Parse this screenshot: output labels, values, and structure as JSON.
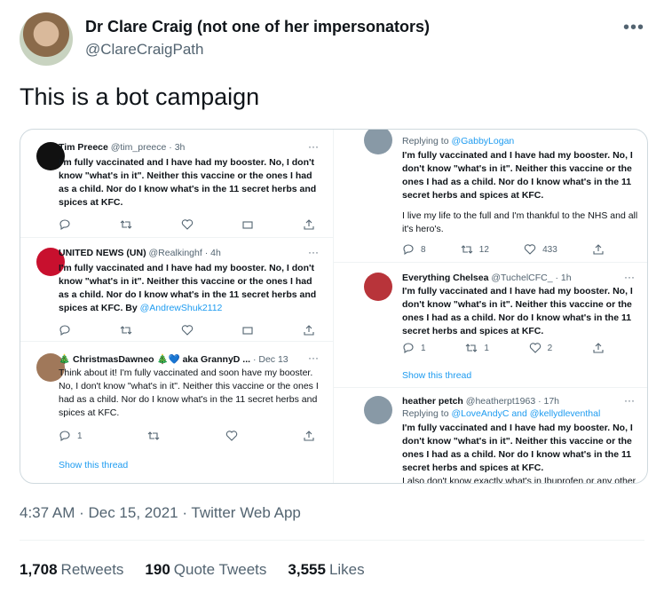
{
  "author": {
    "name": "Dr Clare Craig (not one of her impersonators)",
    "handle": "@ClareCraigPath",
    "more_icon": "more-horizontal-icon"
  },
  "tweet_text": "This is a bot campaign",
  "media": {
    "left": [
      {
        "name": "Tim Preece",
        "meta": "@tim_preece · 3h",
        "text": "I'm fully vaccinated and I  have had my booster. No, I don't know \"what's in it\". Neither this vaccine or the ones I had as a child. Nor do I know what's in the 11 secret herbs and spices at KFC.",
        "actions": [
          "",
          "",
          "",
          "",
          ""
        ]
      },
      {
        "name": "UNITED NEWS (UN)",
        "meta": "@Realkinghf · 4h",
        "text": "I'm fully vaccinated and I  have had my booster. No, I don't know \"what's in it\". Neither this vaccine or the ones I had as a child. Nor do I know what's in the 11 secret herbs and spices at KFC. By",
        "mention": "@AndrewShuk2112"
      },
      {
        "name": "🎄 ChristmasDawneo 🎄💙 aka GrannyD ...",
        "meta": "· Dec 13",
        "text": "Think about it! I'm fully vaccinated and soon have my booster. No, I don't know \"what's in it\". Neither this vaccine or the ones I had as a child. Nor do I know what's in the 11 secret herbs and spices at KFC.",
        "reply_count": "1",
        "show_thread": "Show this thread"
      }
    ],
    "right": [
      {
        "replying_label": "Replying to",
        "replying_to": "@GabbyLogan",
        "text": "I'm fully vaccinated and I have had my booster. No, I don't know \"what's in it\". Neither this vaccine or the ones I had as a child. Nor do I know what's in the 11 secret herbs and spices at KFC.",
        "text2": "I live my life to the full and I'm thankful to the NHS and all it's hero's.",
        "replies": "8",
        "retweets": "12",
        "likes": "433"
      },
      {
        "name": "Everything Chelsea",
        "meta": "@TuchelCFC_ · 1h",
        "text": "I'm fully vaccinated and I  have had my booster. No, I don't know \"what's in it\". Neither this vaccine or the ones I had as a child. Nor do I know what's in the 11 secret herbs and spices at KFC.",
        "replies": "1",
        "retweets": "1",
        "likes": "2",
        "show_thread": "Show this thread"
      },
      {
        "name": "heather petch",
        "meta": "@heatherpt1963 · 17h",
        "replying_label": "Replying to",
        "replying_to": "@LoveAndyC and @kellydleventhal",
        "text": "I'm fully vaccinated and I have had my booster. No, I don't know \"what's in it\". Neither this vaccine or the ones I had as a child. Nor do I know what's in the 11 secret herbs and spices at KFC.",
        "text2": "I also don't know exactly what's in Ibuprofen or any other"
      }
    ]
  },
  "timestamp": "4:37 AM · Dec 15, 2021 · Twitter Web App",
  "stats": {
    "retweets_count": "1,708",
    "retweets_label": "Retweets",
    "quotes_count": "190",
    "quotes_label": "Quote Tweets",
    "likes_count": "3,555",
    "likes_label": "Likes"
  }
}
